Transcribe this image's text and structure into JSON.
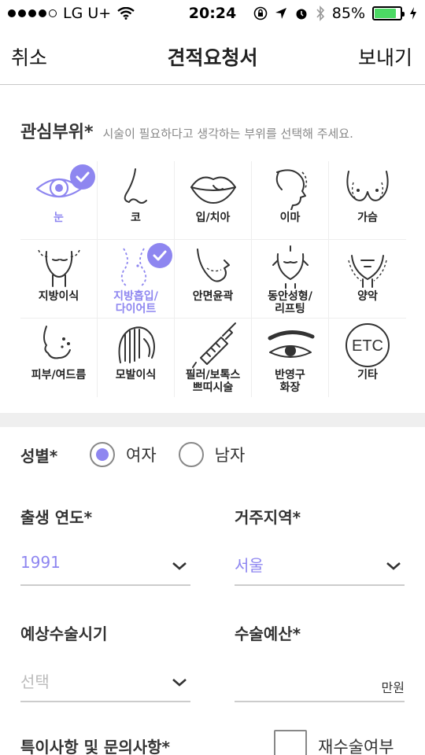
{
  "status_bar": {
    "carrier": "LG U+",
    "time": "20:24",
    "battery": "85%",
    "battery_level": 0.85,
    "signal_icon": "signal-dots-icon",
    "wifi_icon": "wifi-icon"
  },
  "nav": {
    "cancel": "취소",
    "title": "견적요청서",
    "send": "보내기"
  },
  "areas": {
    "title": "관심부위*",
    "hint": "시술이 필요하다고 생각하는 부위를 선택해 주세요.",
    "items": [
      {
        "label": "눈",
        "icon": "eye-icon",
        "selected": true
      },
      {
        "label": "코",
        "icon": "nose-icon",
        "selected": false
      },
      {
        "label": "입/치아",
        "icon": "lips-icon",
        "selected": false
      },
      {
        "label": "이마",
        "icon": "forehead-icon",
        "selected": false
      },
      {
        "label": "가슴",
        "icon": "chest-icon",
        "selected": false
      },
      {
        "label": "지방이식",
        "icon": "fat-graft-icon",
        "selected": false
      },
      {
        "label": "지방흡입/\n다이어트",
        "icon": "liposuction-icon",
        "selected": true
      },
      {
        "label": "안면윤곽",
        "icon": "face-contour-icon",
        "selected": false
      },
      {
        "label": "동안성형/\n리프팅",
        "icon": "lifting-icon",
        "selected": false
      },
      {
        "label": "양악",
        "icon": "jaw-icon",
        "selected": false
      },
      {
        "label": "피부/여드름",
        "icon": "skin-icon",
        "selected": false
      },
      {
        "label": "모발이식",
        "icon": "hair-icon",
        "selected": false
      },
      {
        "label": "필러/보톡스\n쁘띠시술",
        "icon": "syringe-icon",
        "selected": false
      },
      {
        "label": "반영구\n화장",
        "icon": "eyebrow-icon",
        "selected": false
      },
      {
        "label": "기타",
        "icon": "etc-icon",
        "icon_text": "ETC",
        "selected": false
      }
    ]
  },
  "form": {
    "gender_label": "성별*",
    "gender_options": [
      "여자",
      "남자"
    ],
    "gender_selected": "여자",
    "birth_year_label": "출생 연도*",
    "birth_year_value": "1991",
    "region_label": "거주지역*",
    "region_value": "서울",
    "surgery_time_label": "예상수술시기",
    "surgery_time_placeholder": "선택",
    "budget_label": "수술예산*",
    "budget_unit": "만원",
    "notes_label": "특이사항 및 문의사항*",
    "revision_label": "재수술여부"
  },
  "colors": {
    "accent": "#8e86f0",
    "divider": "#efefef",
    "battery_green": "#4cd964"
  }
}
